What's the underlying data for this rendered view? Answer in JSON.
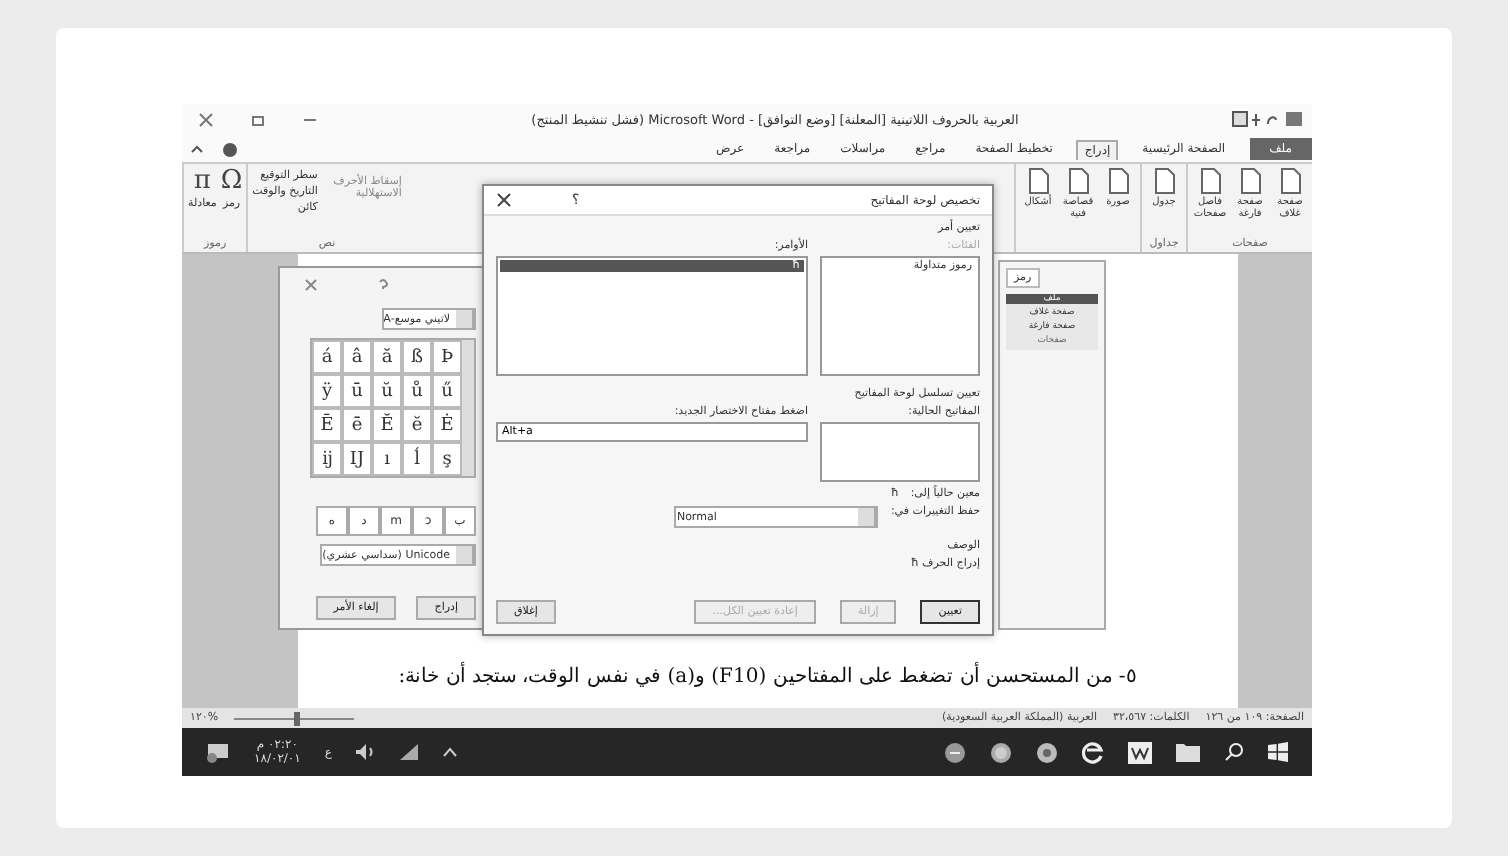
{
  "window": {
    "title": "العربية بالحروف اللاتينية [المعلنة] [وضع التوافق] - Microsoft Word (فشل تنشيط المنتج)"
  },
  "tabs": [
    {
      "label": "ملف",
      "kind": "file",
      "selected": false
    },
    {
      "label": "الصفحة الرئيسية",
      "kind": "tab",
      "selected": false
    },
    {
      "label": "إدراج",
      "kind": "tab",
      "selected": true
    },
    {
      "label": "تخطيط الصفحة",
      "kind": "tab",
      "selected": false
    },
    {
      "label": "مراجع",
      "kind": "tab",
      "selected": false
    },
    {
      "label": "مراسلات",
      "kind": "tab",
      "selected": false
    },
    {
      "label": "مراجعة",
      "kind": "tab",
      "selected": false
    },
    {
      "label": "عرض",
      "kind": "tab",
      "selected": false
    }
  ],
  "ribbon_right": [
    {
      "label": "صفحات",
      "items": [
        "صفحة غلاف",
        "صفحة فارغة",
        "فاصل صفحات"
      ]
    },
    {
      "label": "جداول",
      "items": [
        "جدول"
      ]
    },
    {
      "items": [
        "صورة",
        "قصاصة فنية",
        "أشكال"
      ]
    }
  ],
  "ribbon_left": {
    "symbols": {
      "label": "رموز",
      "items": [
        {
          "glyph": "Ω",
          "label": "رمز"
        },
        {
          "glyph": "π",
          "label": "معادلة"
        }
      ]
    },
    "text": {
      "label": "نص",
      "items": [
        "سطر التوقيع",
        "التاريخ والوقت",
        "كائن"
      ],
      "dropcap": "إسقاط الأحرف الاستهلالية"
    }
  },
  "symbol_dialog": {
    "subset": "لاتيني موسع-A",
    "grid": [
      [
        "Þ",
        "ß",
        "ă",
        "â",
        "á"
      ],
      [
        "ű",
        "ů",
        "ŭ",
        "ū",
        "ÿ"
      ],
      [
        "Ė",
        "ĕ",
        "Ĕ",
        "ē",
        "Ē"
      ],
      [
        "ş",
        "ĺ",
        "ı",
        "Ĳ",
        "ĳ"
      ]
    ],
    "recent": [
      "ب",
      "ɔ",
      "m",
      "د",
      "ه"
    ],
    "code_from": "Unicode (سداسي عشري)",
    "buttons": [
      "إدراج",
      "إلغاء الأمر"
    ]
  },
  "side_panel": {
    "tab": "رمز",
    "file": "ملف",
    "items": [
      "صفحة غلاف",
      "صفحة فارغة"
    ],
    "group": "صفحات"
  },
  "dialog": {
    "title": "تخصيص لوحة المفاتيح",
    "help": "؟",
    "assign": "تعيين أمر",
    "categories_label": "الفئات:",
    "categories": [
      {
        "label": "رموز متداولة",
        "selected": false
      }
    ],
    "commands_label": "الأوامر:",
    "commands": [
      {
        "label": "ħ",
        "selected": true
      }
    ],
    "sequence": "تعيين تسلسل لوحة المفاتيح",
    "current_label": "المفاتيح الحالية:",
    "new_label": "اضغط مفتاح الاختصار الجديد:",
    "new_value": "Alt+a",
    "assigned_label": "معين حالياً إلى:",
    "assigned": "ħ",
    "save_label": "حفظ التغييرات في:",
    "save_value": "Normal",
    "desc_label": "الوصف",
    "desc": "إدراج الحرف ħ",
    "buttons": [
      {
        "label": "تعيين",
        "disabled": false,
        "default": true
      },
      {
        "label": "إزالة",
        "disabled": true,
        "default": false
      },
      {
        "label": "إعادة تعيين الكل...",
        "disabled": true,
        "default": false
      },
      {
        "label": "إغلاق",
        "disabled": false,
        "default": false
      }
    ]
  },
  "caption": "٥- من المستحسن أن تضغط على المفتاحين (F10) و(a) في نفس الوقت، ستجد أن خانة:",
  "status_bar": {
    "items": [
      "الصفحة: ١٠٩ من ١٢٦",
      "الكلمات: ٣٢،٥٦٧",
      "العربية (المملكة العربية السعودية)"
    ],
    "zoom": "%١٢٠",
    "zoom_slider": {
      "level": 0.5
    }
  },
  "taskbar": {
    "time": "٠٢:٢٠ م",
    "date": "١٨/٠٢/٠١",
    "lang": "ع"
  }
}
